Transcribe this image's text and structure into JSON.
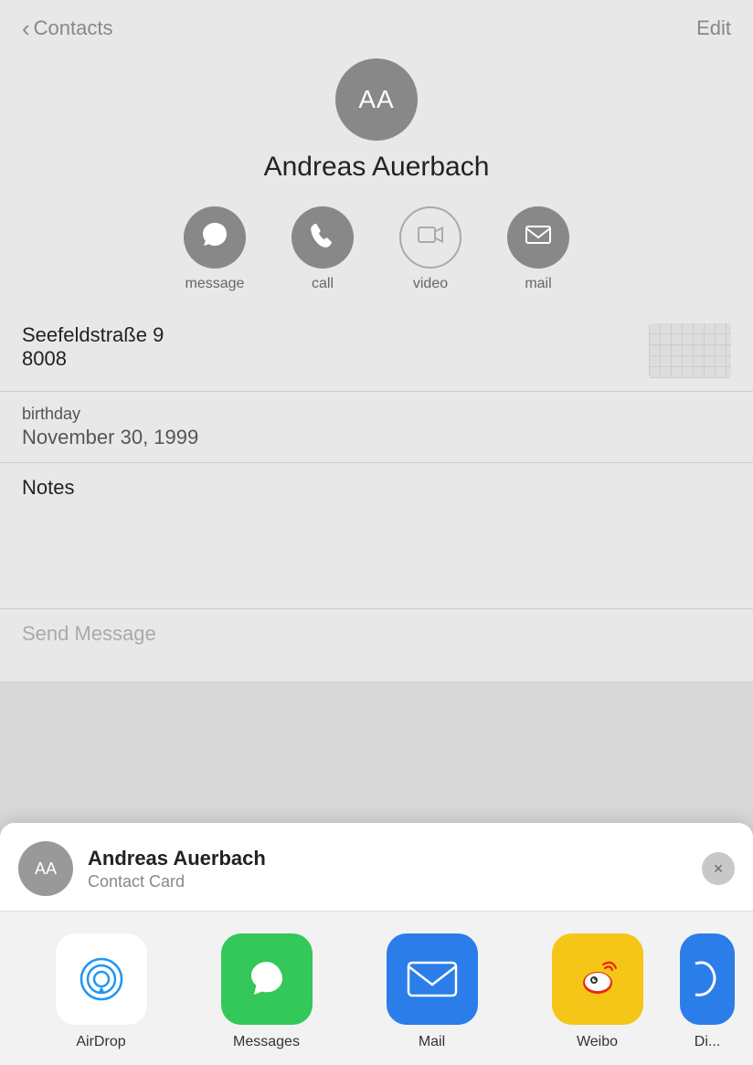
{
  "nav": {
    "back_label": "Contacts",
    "edit_label": "Edit"
  },
  "contact": {
    "initials": "AA",
    "name": "Andreas Auerbach"
  },
  "actions": [
    {
      "id": "message",
      "label": "message",
      "icon": "💬",
      "disabled": false
    },
    {
      "id": "call",
      "label": "call",
      "icon": "📞",
      "disabled": false
    },
    {
      "id": "video",
      "label": "video",
      "icon": "📹",
      "disabled": true
    },
    {
      "id": "mail",
      "label": "mail",
      "icon": "✉️",
      "disabled": false
    }
  ],
  "address": {
    "street": "Seefeldstraße 9",
    "postal": "8008"
  },
  "birthday": {
    "label": "birthday",
    "value": "November 30, 1999"
  },
  "notes": {
    "label": "Notes"
  },
  "send_message": {
    "label": "Send Message"
  },
  "share_sheet": {
    "contact_name": "Andreas Auerbach",
    "contact_subtitle": "Contact Card",
    "initials": "AA",
    "close_icon": "×",
    "apps": [
      {
        "id": "airdrop",
        "label": "AirDrop",
        "type": "airdrop"
      },
      {
        "id": "messages",
        "label": "Messages",
        "type": "messages"
      },
      {
        "id": "mail",
        "label": "Mail",
        "type": "mail"
      },
      {
        "id": "weibo",
        "label": "Weibo",
        "type": "weibo"
      },
      {
        "id": "partial",
        "label": "Di...",
        "type": "partial"
      }
    ]
  }
}
